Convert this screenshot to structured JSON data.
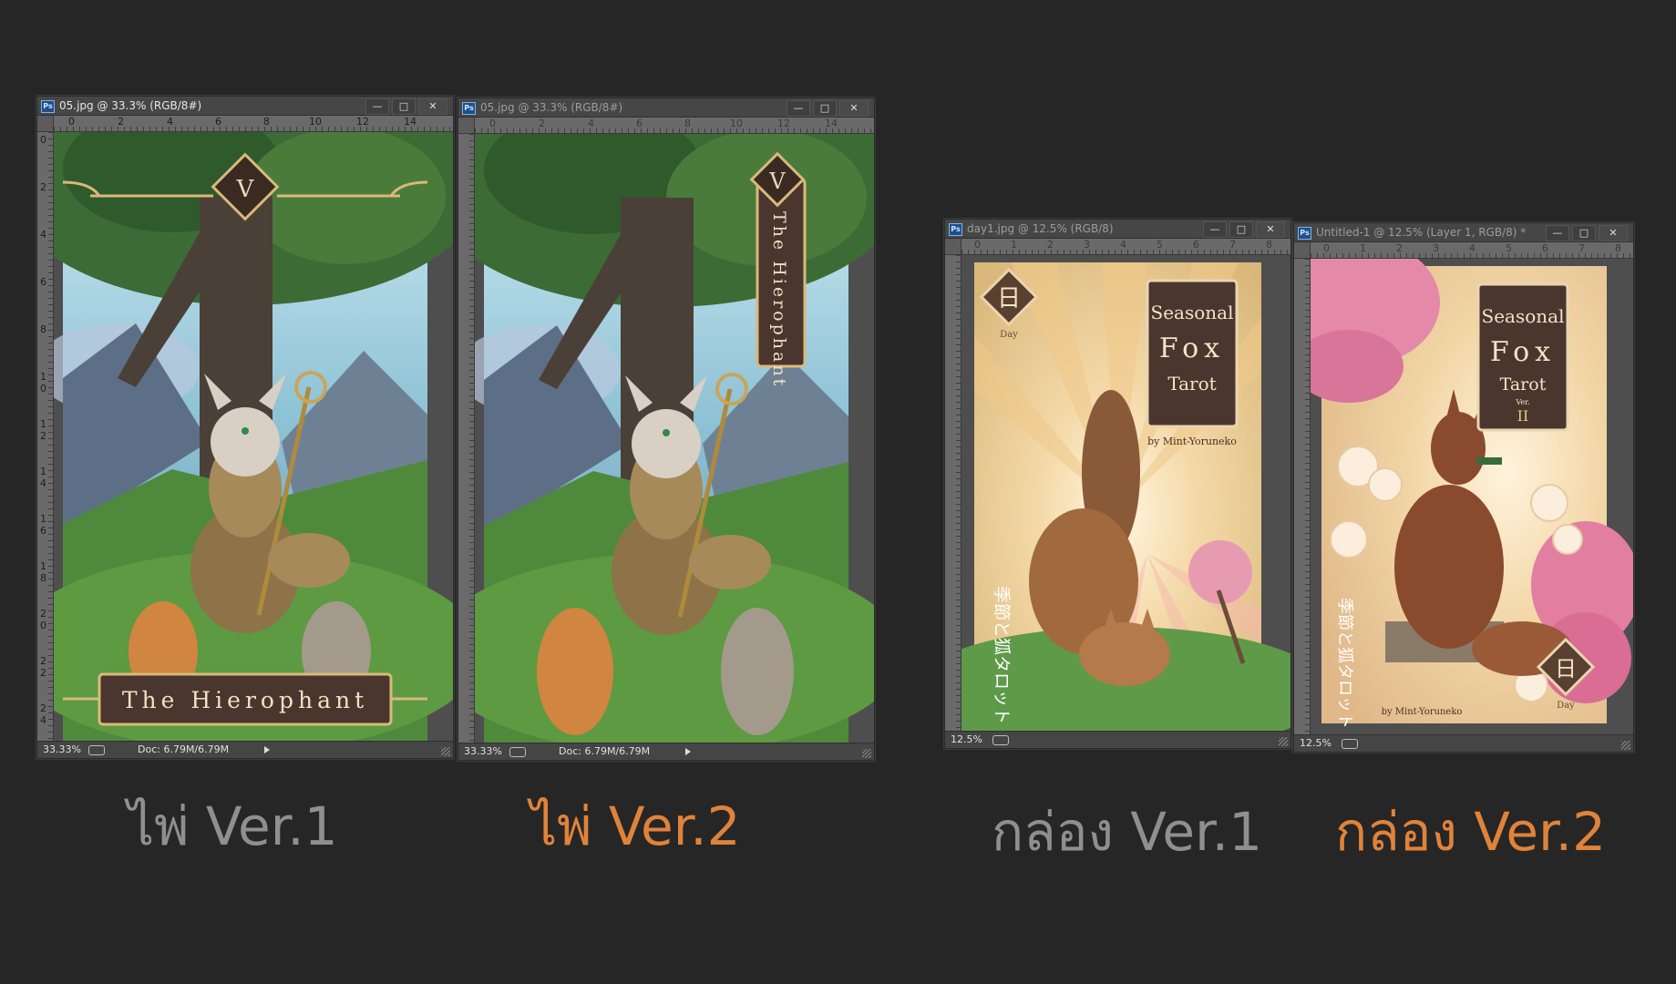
{
  "windows": [
    {
      "title": "05.jpg @ 33.3% (RGB/8#)",
      "active": true,
      "ruler_labels": [
        "0",
        "2",
        "4",
        "6",
        "8",
        "10",
        "12",
        "14"
      ],
      "ruler_v_labels": [
        "0",
        "2",
        "4",
        "6",
        "8",
        "1 0",
        "1 2",
        "1 4",
        "1 6",
        "1 8",
        "2 0",
        "2 2",
        "2 4"
      ],
      "zoom": "33.33%",
      "doc_info": "Doc: 6.79M/6.79M",
      "card": {
        "numeral": "V",
        "banner": "The Hierophant"
      }
    },
    {
      "title": "05.jpg @ 33.3% (RGB/8#)",
      "active": false,
      "ruler_labels": [
        "0",
        "2",
        "4",
        "6",
        "8",
        "10",
        "12",
        "14"
      ],
      "zoom": "33.33%",
      "doc_info": "Doc: 6.79M/6.79M",
      "card": {
        "numeral": "V",
        "vertical_title": "The Hierophant"
      }
    },
    {
      "title": "day1.jpg @ 12.5% (RGB/8)",
      "active": false,
      "ruler_labels": [
        "0",
        "1",
        "2",
        "3",
        "4",
        "5",
        "6",
        "7",
        "8"
      ],
      "zoom": "12.5%",
      "box": {
        "kanji_badge": "日",
        "badge_caption": "Day",
        "title_line1": "Seasonal",
        "title_line2": "Fox",
        "title_line3": "Tarot",
        "credit": "by Mint-Yoruneko",
        "japanese": "季節と狐タロット"
      }
    },
    {
      "title": "Untitled-1 @ 12.5% (Layer 1, RGB/8) *",
      "active": false,
      "ruler_labels": [
        "0",
        "1",
        "2",
        "3",
        "4",
        "5",
        "6",
        "7",
        "8"
      ],
      "zoom": "12.5%",
      "box": {
        "kanji_badge": "日",
        "badge_caption": "Day",
        "title_line1": "Seasonal",
        "title_line2": "Fox",
        "title_line3": "Tarot",
        "ver_label": "Ver.",
        "ver_numeral": "II",
        "credit": "by Mint-Yoruneko",
        "japanese": "季節と狐タロット"
      }
    }
  ],
  "captions": {
    "card_v1": "ไพ่ Ver.1",
    "card_v2": "ไพ่ Ver.2",
    "box_v1": "กล่อง Ver.1",
    "box_v2": "กล่อง Ver.2"
  },
  "colors": {
    "background": "#262626",
    "caption_gray": "#8f8f8f",
    "caption_orange": "#e0833a",
    "card_gold": "#d9b97a"
  },
  "icons": {
    "minimize": "minimize-icon",
    "maximize": "maximize-icon",
    "close": "close-icon"
  }
}
